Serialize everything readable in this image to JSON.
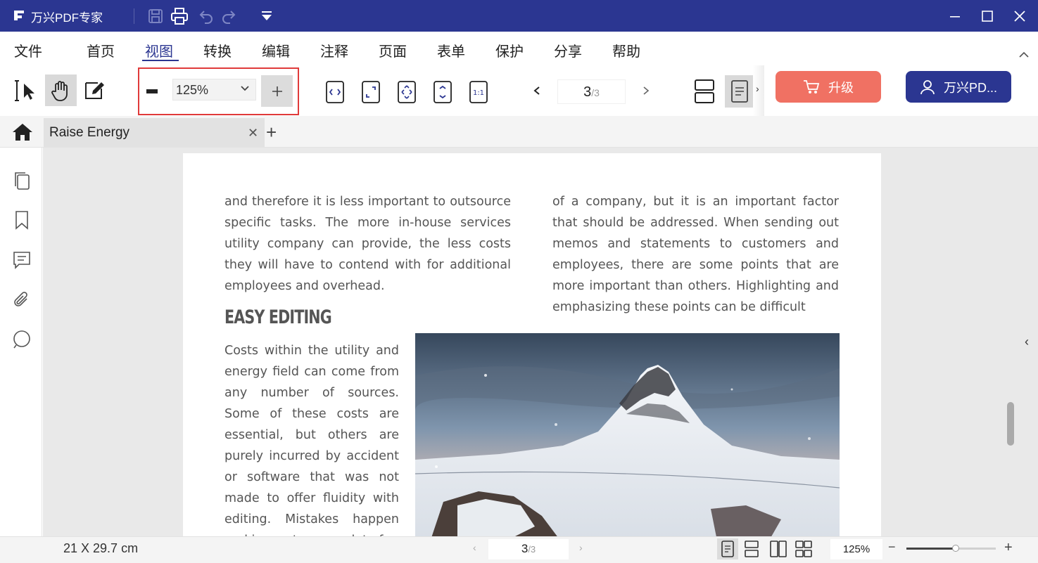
{
  "app": {
    "title": "万兴PDF专家"
  },
  "menu": {
    "file": "文件",
    "items": [
      "首页",
      "视图",
      "转换",
      "编辑",
      "注释",
      "页面",
      "表单",
      "保护",
      "分享",
      "帮助"
    ],
    "active": "视图"
  },
  "toolbar": {
    "zoom_value": "125%",
    "current_page": "3",
    "total_pages": "/3",
    "upgrade_label": "升级",
    "account_label": "万兴PD..."
  },
  "tabs": {
    "doc_title": "Raise Energy"
  },
  "document": {
    "left_column": "and therefore it is less important to outsource specific tasks. The more in-house services utility company can provide, the less costs they will have to contend with for additional employees and overhead.",
    "right_column": "of a company, but it is an important factor that should be addressed. When sending out memos and statements to customers and employees, there are some points that are more important than others. Highlighting and emphasizing these points can be difficult",
    "heading": "EASY EDITING",
    "narrow_column": "Costs within the utility and energy field can come from any number of sources. Some of these costs are essential, but others are purely incurred by accident or software that was not made to offer fluidity with editing. Mistakes happen and in most cases a lot of"
  },
  "status": {
    "page_size": "21 X 29.7 cm",
    "current_page": "3",
    "total_pages": "/3",
    "zoom": "125%",
    "zoom_level_fraction": 0.55
  },
  "colors": {
    "brand": "#2b3691",
    "upgrade": "#f07163",
    "highlight_box": "#e03a3a"
  }
}
